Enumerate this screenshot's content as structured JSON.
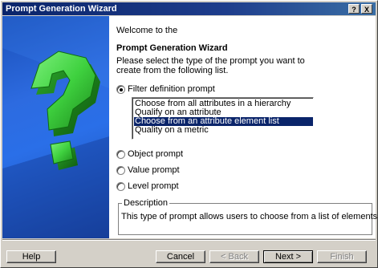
{
  "window": {
    "title": "Prompt Generation Wizard",
    "help_glyph": "?",
    "close_glyph": "X"
  },
  "page": {
    "welcome": "Welcome to the",
    "wizard_title": "Prompt Generation Wizard",
    "instructions": "Please select the type of the prompt you want to create from the following list."
  },
  "options": {
    "filter": {
      "label": "Filter definition prompt",
      "checked": true
    },
    "object": {
      "label": "Object prompt",
      "checked": false
    },
    "value": {
      "label": "Value prompt",
      "checked": false
    },
    "level": {
      "label": "Level prompt",
      "checked": false
    }
  },
  "filter_list": {
    "items": [
      "Choose from all attributes in a hierarchy",
      "Qualify on an attribute",
      "Choose from an attribute element list",
      "Quality on a metric"
    ],
    "selected_index": 2
  },
  "description": {
    "legend": "Description",
    "text": "This type of prompt allows users to choose from a list of elements."
  },
  "buttons": {
    "help": "Help",
    "cancel": "Cancel",
    "back": "< Back",
    "next": "Next >",
    "finish": "Finish"
  },
  "icons": {
    "wizard_art": "question-mark-graphic",
    "accent": "#0a246a",
    "art_blue": "#2a6fe8",
    "art_green": "#3fd13f"
  }
}
